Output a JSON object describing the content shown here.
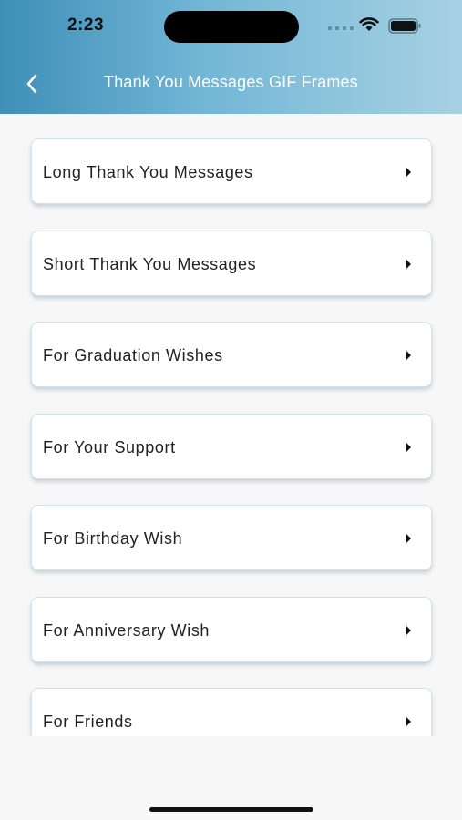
{
  "status": {
    "time": "2:23"
  },
  "header": {
    "title": "Thank You Messages GIF Frames",
    "back_icon": "chevron-left-icon"
  },
  "list": {
    "items": [
      {
        "label": "Long Thank You Messages"
      },
      {
        "label": "Short Thank You Messages"
      },
      {
        "label": "For Graduation Wishes"
      },
      {
        "label": "For Your Support"
      },
      {
        "label": "For Birthday Wish"
      },
      {
        "label": "For Anniversary Wish"
      },
      {
        "label": "For Friends"
      }
    ],
    "item_icon": "play-arrow-icon"
  },
  "colors": {
    "header_start": "#3f8fb8",
    "header_end": "#a7d1e3",
    "background": "#f7f7f7",
    "card_border": "#cfe3ee"
  }
}
